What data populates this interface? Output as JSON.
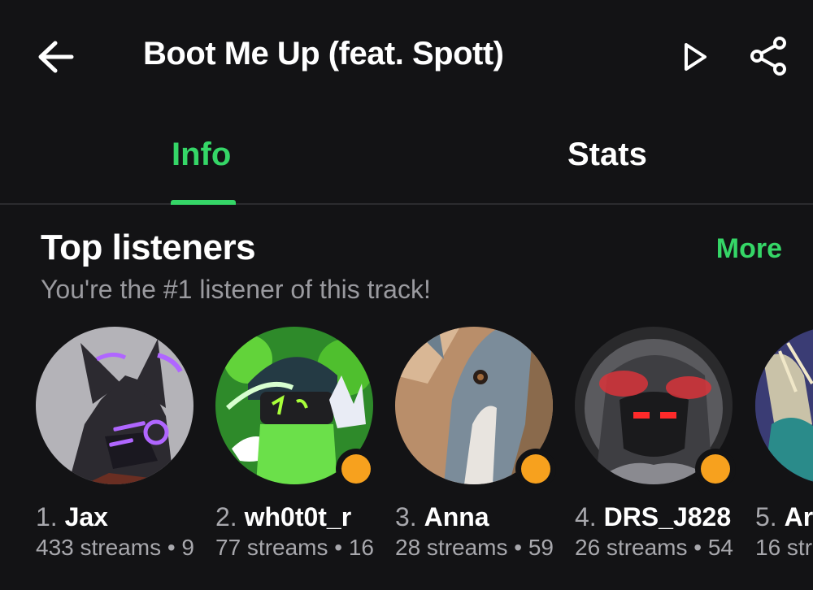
{
  "header": {
    "title": "Boot Me Up (feat. Spott)"
  },
  "tabs": [
    {
      "label": "Info",
      "active": true
    },
    {
      "label": "Stats",
      "active": false
    }
  ],
  "top_listeners": {
    "title": "Top listeners",
    "more_label": "More",
    "subtitle": "You're the #1 listener of this track!",
    "items": [
      {
        "rank": "1.",
        "name": "Jax",
        "stats": "433 streams • 9",
        "badge": false
      },
      {
        "rank": "2.",
        "name": "wh0t0t_r",
        "stats": "77 streams • 16",
        "badge": true
      },
      {
        "rank": "3.",
        "name": "Anna",
        "stats": "28 streams • 59",
        "badge": true
      },
      {
        "rank": "4.",
        "name": "DRS_J828",
        "stats": "26 streams • 54",
        "badge": true
      },
      {
        "rank": "5.",
        "name": "Ar",
        "stats": "16 str",
        "badge": false
      }
    ]
  },
  "colors": {
    "accent": "#35d667",
    "background": "#131315",
    "badge": "#f7a11e"
  }
}
